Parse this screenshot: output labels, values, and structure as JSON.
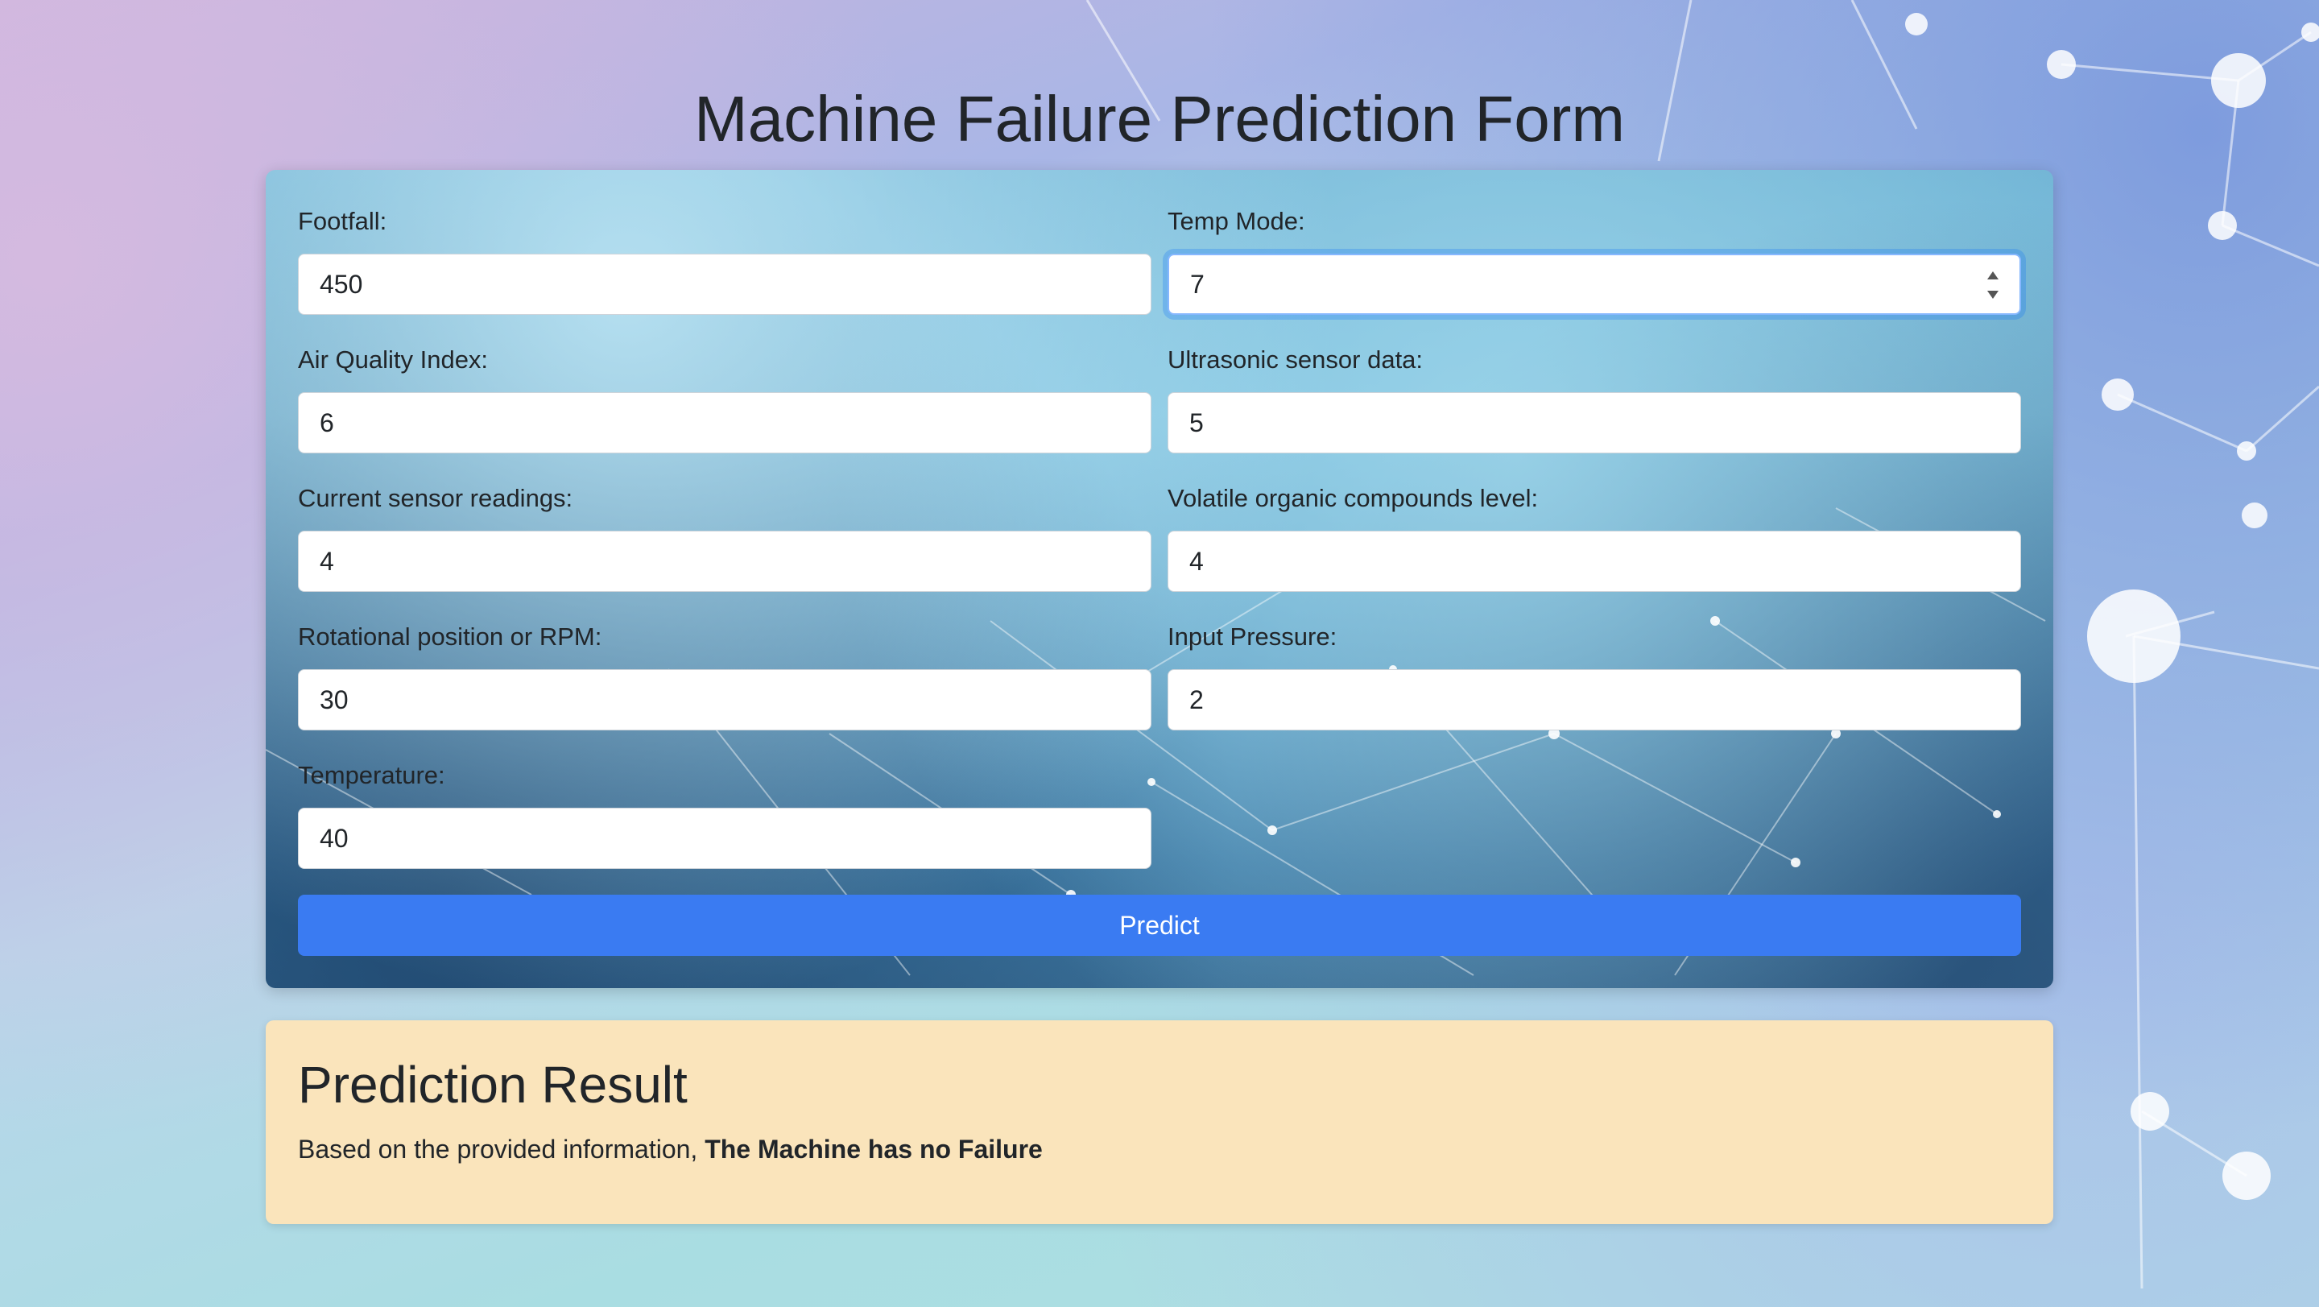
{
  "page": {
    "title": "Machine Failure Prediction Form"
  },
  "form": {
    "fields": [
      {
        "label": "Footfall:",
        "value": "450"
      },
      {
        "label": "Temp Mode:",
        "value": "7"
      },
      {
        "label": "Air Quality Index:",
        "value": "6"
      },
      {
        "label": "Ultrasonic sensor data:",
        "value": "5"
      },
      {
        "label": "Current sensor readings:",
        "value": "4"
      },
      {
        "label": "Volatile organic compounds level:",
        "value": "4"
      },
      {
        "label": "Rotational position or RPM:",
        "value": "30"
      },
      {
        "label": "Input Pressure:",
        "value": "2"
      },
      {
        "label": "Temperature:",
        "value": "40"
      }
    ],
    "submit_label": "Predict"
  },
  "result": {
    "title": "Prediction Result",
    "prefix": "Based on the provided information, ",
    "outcome": "The Machine has no Failure"
  },
  "colors": {
    "primary_button": "#3a7bf2",
    "result_background": "#fae4bb",
    "focus_ring": "#86b7fe"
  }
}
